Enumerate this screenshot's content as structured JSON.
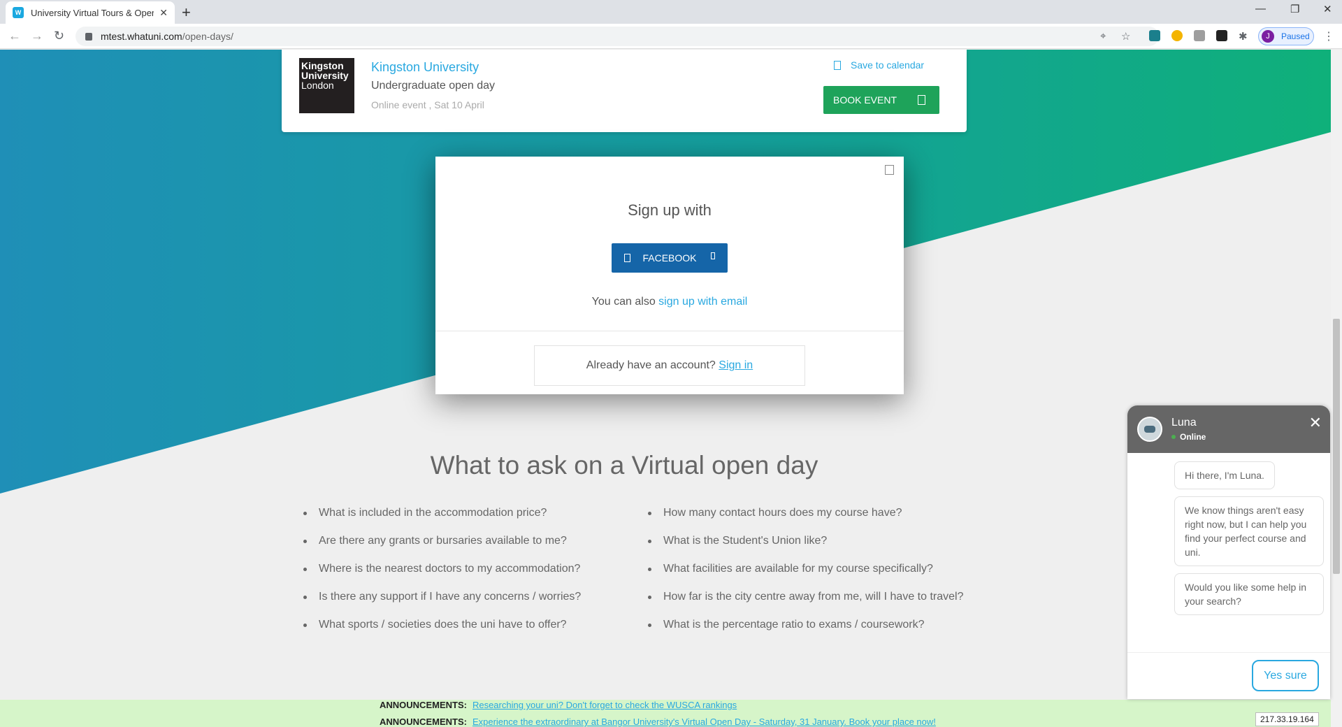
{
  "browser": {
    "tab_title": "University Virtual Tours & Open D",
    "favicon_text": "W",
    "url_host": "mtest.whatuni.com",
    "url_path": "/open-days/",
    "profile_initial": "J",
    "profile_status": "Paused"
  },
  "event": {
    "logo_line1": "Kingston",
    "logo_line2": "University",
    "logo_line3": "London",
    "university": "Kingston University",
    "event_type": "Undergraduate open day",
    "when": "Online event , Sat 10 April",
    "save_label": "Save to calendar",
    "book_label": "BOOK EVENT"
  },
  "modal": {
    "title": "Sign up with",
    "facebook_label": "FACEBOOK",
    "alt_prefix": "You can also ",
    "alt_link": "sign up with email",
    "account_prefix": "Already have an account? ",
    "signin_link": "Sign in"
  },
  "section": {
    "title": "What to ask on a Virtual open day",
    "left_questions": [
      "What is included in the accommodation price?",
      "Are there any grants or bursaries available to me?",
      "Where is the nearest doctors to my accommodation?",
      "Is there any support if I have any concerns / worries?",
      "What sports / societies does the uni have to offer?"
    ],
    "right_questions": [
      "How many contact hours does my course have?",
      "What is the Student's Union like?",
      "What facilities are available for my course specifically?",
      "How far is the city centre away from me, will I have to travel?",
      "What is the percentage ratio to exams / coursework?"
    ]
  },
  "announcements": [
    {
      "label": "ANNOUNCEMENTS:",
      "text": "Researching your uni? Don't forget to check the WUSCA rankings"
    },
    {
      "label": "ANNOUNCEMENTS:",
      "text": "Experience the extraordinary at Bangor University's Virtual Open Day - Saturday, 31 January. Book your place now!"
    }
  ],
  "ip_address": "217.33.19.164",
  "chat": {
    "name": "Luna",
    "status": "Online",
    "messages": [
      "Hi there, I'm Luna.",
      "We know things aren't easy right now, but I can help you find your perfect course and uni.",
      "Would you like some help in your search?"
    ],
    "reply_label": "Yes sure"
  },
  "colors": {
    "accent_blue": "#29a8e0",
    "book_green": "#1ea35a",
    "facebook_blue": "#1565a8",
    "gradient_start": "#1f8fb7",
    "gradient_end": "#0fb07a"
  }
}
